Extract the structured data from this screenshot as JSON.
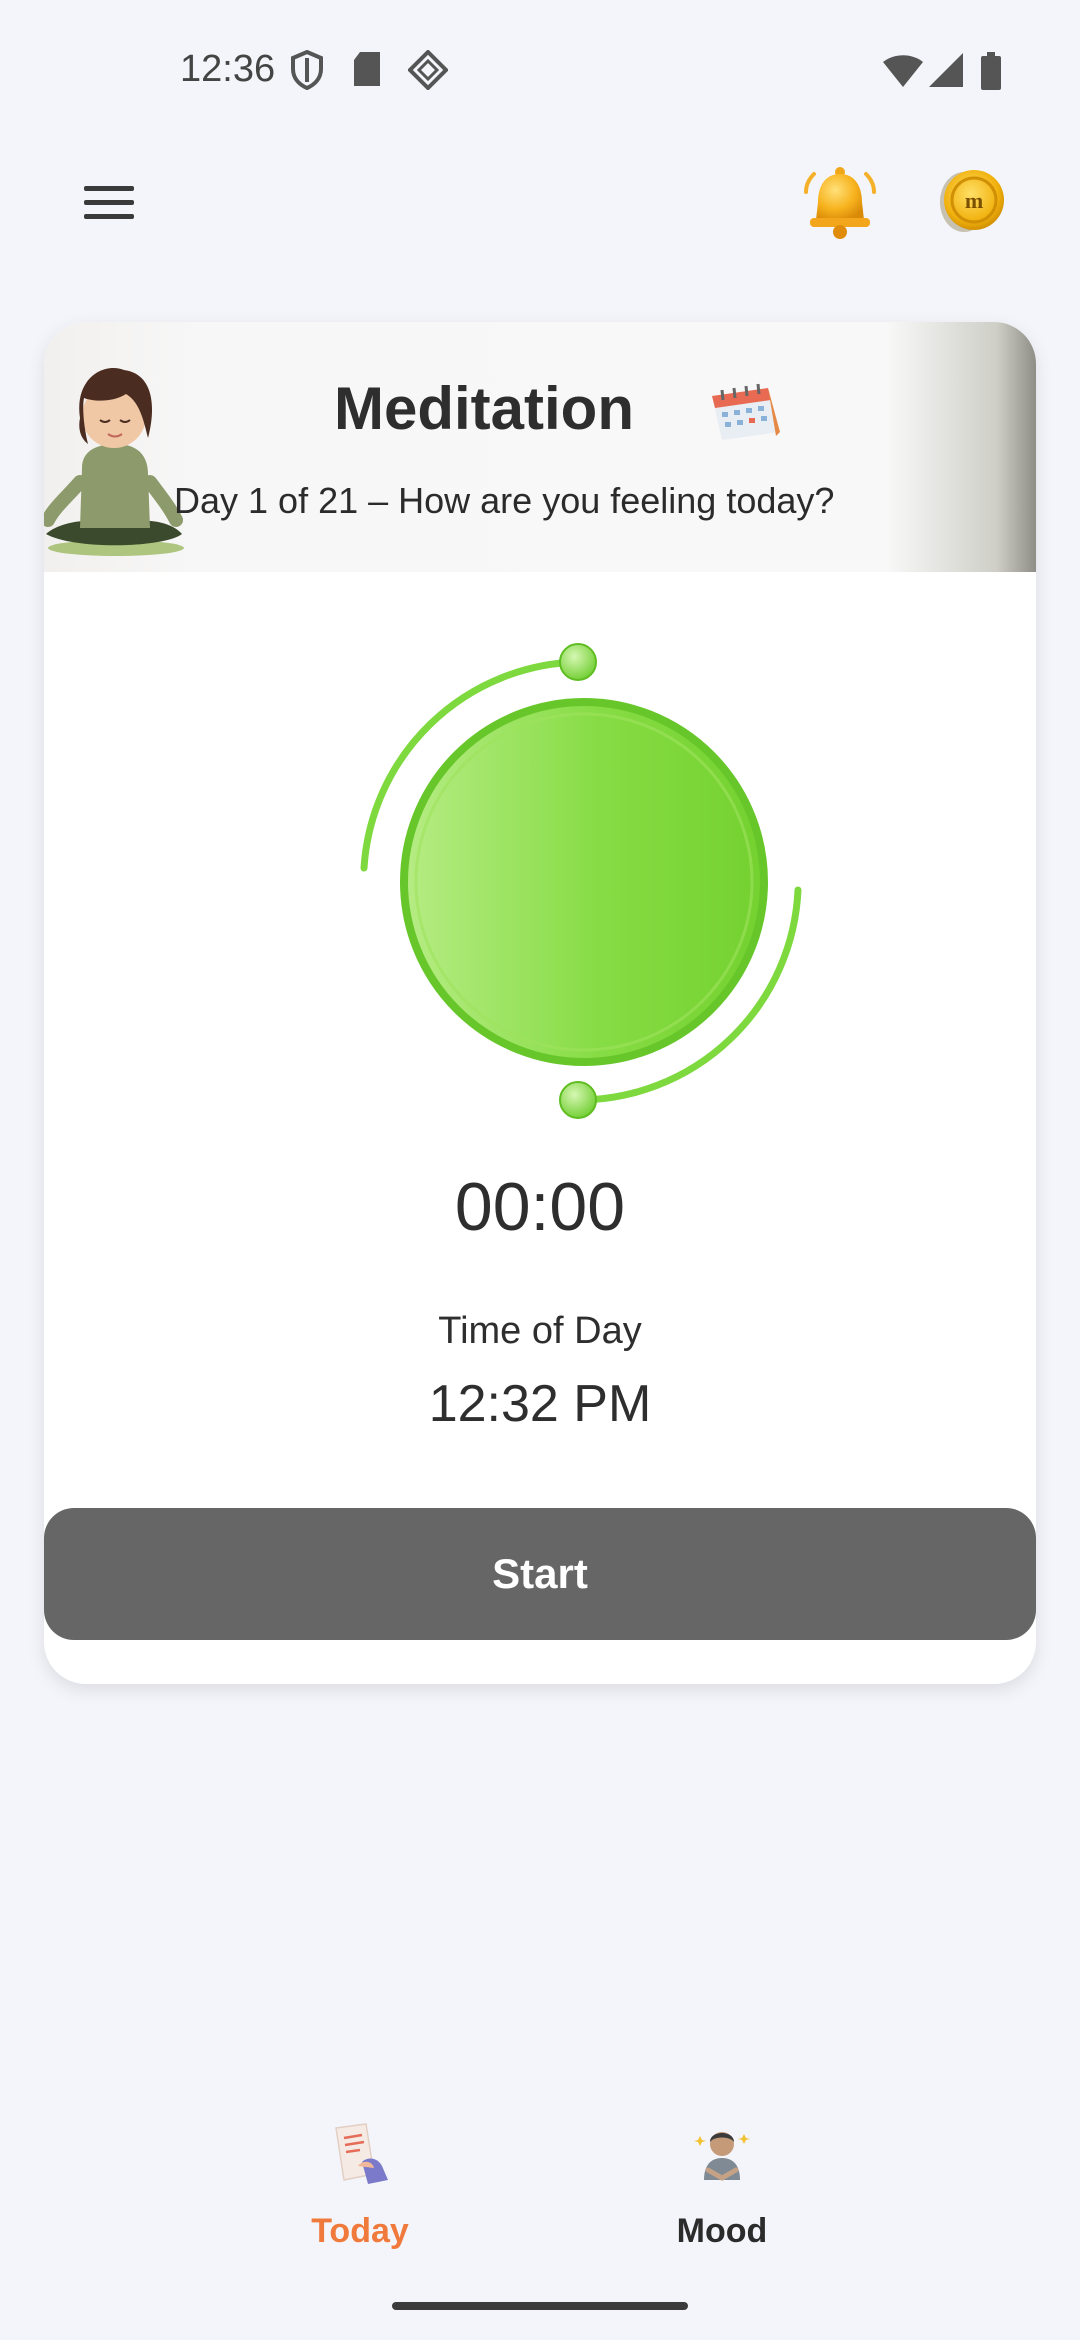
{
  "status_bar": {
    "time": "12:36",
    "left_icons": [
      "shield-icon",
      "sd-card-icon",
      "app-diamond-icon"
    ],
    "right_icons": [
      "wifi-icon",
      "signal-icon",
      "battery-icon"
    ]
  },
  "app_bar": {
    "menu_icon": "hamburger-menu-icon",
    "notification_icon": "bell-icon",
    "coins_icon": "coin-icon"
  },
  "card": {
    "title": "Meditation",
    "title_icon": "calendar-icon",
    "subtitle": "Day 1 of 21 – How are you feeling today?",
    "timer": "00:00",
    "time_of_day_label": "Time of Day",
    "time_of_day_value": "12:32 PM",
    "start_label": "Start"
  },
  "bottom_nav": {
    "items": [
      {
        "label": "Today",
        "icon": "journal-icon",
        "active": true
      },
      {
        "label": "Mood",
        "icon": "person-meditating-icon",
        "active": false
      }
    ]
  },
  "colors": {
    "background": "#f4f5fa",
    "accent_active": "#f07a3c",
    "timer_green": "#7ed93e",
    "start_button": "#666666"
  }
}
